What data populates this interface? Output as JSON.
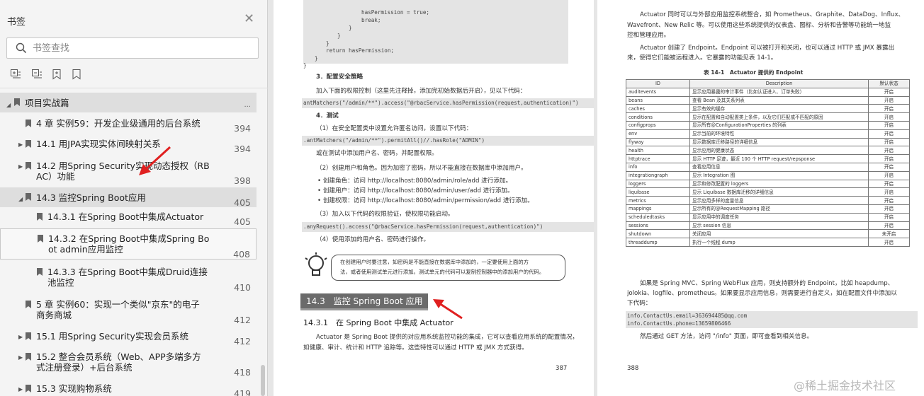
{
  "sidebar": {
    "title": "书签",
    "search_placeholder": "书签查找",
    "items": [
      {
        "label": "项目实战篇",
        "page": "..."
      },
      {
        "label": "4 章 实例59：开发企业级通用的后台系统",
        "page": "394"
      },
      {
        "label": "14.1 用JPA实现实体间映射关系",
        "page": "394"
      },
      {
        "label_1": "14.2 用Spring Security实现动态授权（RB",
        "label_2": "AC）功能",
        "page": "398"
      },
      {
        "label": "14.3 监控Spring Boot应用",
        "page": "405"
      },
      {
        "label": "14.3.1 在Spring Boot中集成Actuator",
        "page": "405"
      },
      {
        "label_1": "14.3.2 在Spring Boot中集成Spring Bo",
        "label_2": "ot admin应用监控",
        "page": "408"
      },
      {
        "label_1": "14.3.3 在Spring Boot中集成Druid连接",
        "label_2": "池监控",
        "page": "410"
      },
      {
        "label_1": "5 章 实例60：实现一个类似\"京东\"的电子",
        "label_2": "商务商城",
        "page": "412"
      },
      {
        "label": "15.1 用Spring Security实现会员系统",
        "page": "412"
      },
      {
        "label_1": "15.2 整合会员系统（Web、APP多端多方",
        "label_2": "式注册登录）+后台系统",
        "page": "418"
      },
      {
        "label": "15.3 实现购物系统",
        "page": "419"
      }
    ]
  },
  "left_page": {
    "code1": [
      "hasPermission = true;",
      "break;",
      "}",
      "}",
      "}",
      "return hasPermission;",
      "}",
      "}"
    ],
    "s3": "3．配置安全策略",
    "p1": "加入下面的权限控制（这里先注释掉，添加完初始数据后开启），见以下代码：",
    "code2": "antMatchers(\"/admin/**\").access(\"@rbacService.hasPermission(request,authentication)\")",
    "s4": "4．测试",
    "p2": "（1）在安全配置类中设置允许匿名访问，设置以下代码：",
    "code3": ".antMatchers(\"/admin/**\").permitAll()//.hasRole(\"ADMIN\")",
    "p3": "或在测试中添加用户名、密码，并配置权限。",
    "p4": "（2）创建用户和角色。因为加密了密码，所以不能直接在数据库中添加用户。",
    "b1": "创建角色：访问 http://localhost:8080/admin/role/add 进行添加。",
    "b2": "创建用户：访问 http://localhost:8080/admin/user/add 进行添加。",
    "b3": "创建权限：访问 http://localhost:8080/admin/permission/add 进行添加。",
    "p5": "（3）加入以下代码的权限验证，使权限功能启动。",
    "code4": ".anyRequest().access(\"@rbacService.hasPermission(request,authentication)\")",
    "p6": "（4）使用添加的用户名、密码进行操作。",
    "tip1": "在创建用户时要注意，如密码是不能直接在数据库中添加的，一定要使用上面的方",
    "tip2": "法，或者使用测试单元进行添加。测试单元的代码可以复制控制器中的添加用户的代码。",
    "section": "14.3　监控 Spring Boot 应用",
    "subsection": "14.3.1　在 Spring Boot 中集成 Actuator",
    "p7": "Actuator 是 Spring Boot 提供的对应用系统监控功能的集成，它可以查看应用系统的配置情况，",
    "p8": "如健康、审计、统计和 HTTP 追踪等。这些特性可以通过 HTTP 或 JMX 方式获得。",
    "page_no": "387"
  },
  "right_page": {
    "r1": "Actuator 同时可以与外部应用监控系统整合，如 Prometheus、Graphite、DataDog、Influx、",
    "r2": "Wavefront、New Relic 等。可以使用这些系统提供的仪表盘、图标、分析和告警等功能统一地监",
    "r3": "控和管理应用。",
    "r4": "Actuator 创建了 Endpoint。Endpoint 可以被打开和关闭，也可以通过 HTTP 或 JMX 暴露出",
    "r5": "来，使得它们能被远程进入。它暴露的功能见表 14-1。",
    "table_caption": "表 14-1　Actuator 提供的 Endpoint",
    "table_headers": [
      "ID",
      "Description",
      "默认状态"
    ],
    "table_rows": [
      [
        "auditevents",
        "显示应用暴露的审计事件（比如认证进入、订单失败）",
        "开启"
      ],
      [
        "beans",
        "查看 Bean 及其关系列表",
        "开启"
      ],
      [
        "caches",
        "显示有效的缓存",
        "开启"
      ],
      [
        "conditions",
        "显示在配置和自动配置类上条件，以及它们匹配或不匹配的原因",
        "开启"
      ],
      [
        "configprops",
        "显示所有@ConfigurationProperties 的列表",
        "开启"
      ],
      [
        "env",
        "显示当前的环境特性",
        "开启"
      ],
      [
        "flyway",
        "显示数据库迁移路径的详细信息",
        "开启"
      ],
      [
        "health",
        "显示应用的健康状态",
        "开启"
      ],
      [
        "httptrace",
        "显示 HTTP 足迹，最近 100 个 HTTP request/repsponse",
        "开启"
      ],
      [
        "info",
        "查看应用信息",
        "开启"
      ],
      [
        "integrationgraph",
        "显示 Integration 图",
        "开启"
      ],
      [
        "loggers",
        "显示和修改配置的 loggers",
        "开启"
      ],
      [
        "liquibase",
        "显示 Liquibase 数据库迁移的详细信息",
        "开启"
      ],
      [
        "metrics",
        "显示应用多样的度量信息",
        "开启"
      ],
      [
        "mappings",
        "显示所有的@RequestMapping 路径",
        "开启"
      ],
      [
        "scheduledtasks",
        "显示应用中的调度任务",
        "开启"
      ],
      [
        "sessions",
        "显示 session 信息",
        "开启"
      ],
      [
        "shutdown",
        "关闭应用",
        "未开启"
      ],
      [
        "threaddump",
        "执行一个线程 dump",
        "开启"
      ]
    ],
    "r6": "如果是 Spring MVC、Spring WebFlux 应用，则支持额外的 Endpoint，比如 heapdump、",
    "r7": "jolokia、logfile、prometheus。如果要显示应用信息，则需要进行自定义，如在配置文件中添加以",
    "r8": "下代码：",
    "code_a": "info.ContactUs.email=363694485@qq.com",
    "code_b": "info.ContactUs.phone=13659806466",
    "r9": "然后通过 GET 方法，访问 \"/info\" 页面，即可查看到相关信息。",
    "page_no": "388"
  },
  "watermark": "@稀土掘金技术社区",
  "colors": {
    "annotation_arrow": "#e02020",
    "section_bar": "#6b6b6b"
  }
}
